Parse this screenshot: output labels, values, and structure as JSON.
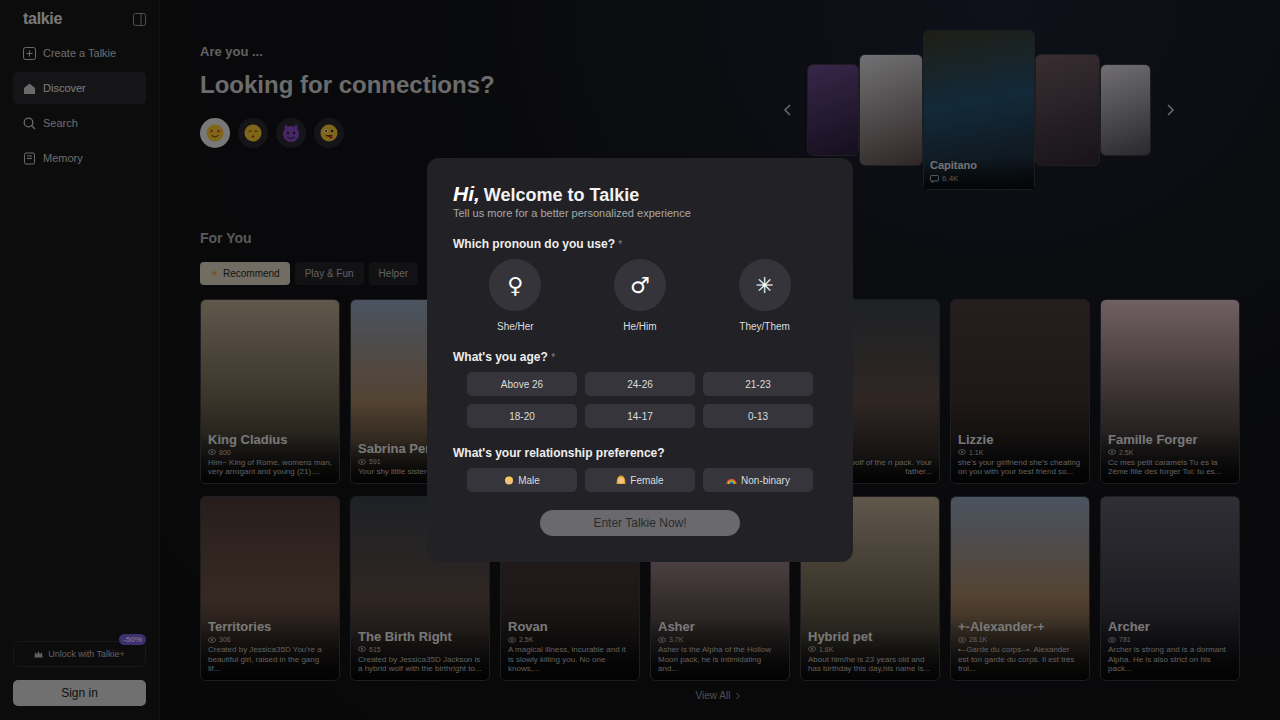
{
  "sidebar": {
    "logo": "talkie",
    "items": [
      {
        "label": "Create a Talkie",
        "kind": "create",
        "selected": false
      },
      {
        "label": "Discover",
        "kind": "home",
        "selected": true
      },
      {
        "label": "Search",
        "kind": "search",
        "selected": false
      },
      {
        "label": "Memory",
        "kind": "memory",
        "selected": false
      }
    ],
    "promo": {
      "label": "Unlock with Talkie+",
      "badge": "-50%"
    },
    "sign_in": "Sign in"
  },
  "hero": {
    "kicker": "Are you ...",
    "title": "Looking for connections?",
    "moods": [
      {
        "kind": "love",
        "selected": true
      },
      {
        "kind": "kiss",
        "selected": false
      },
      {
        "kind": "devil",
        "selected": false
      },
      {
        "kind": "silly",
        "selected": false
      }
    ]
  },
  "carousel": {
    "slides": [
      {
        "featured": false,
        "name": "",
        "count": ""
      },
      {
        "featured": false,
        "name": "",
        "count": ""
      },
      {
        "featured": true,
        "name": "Capitano",
        "count": "6.4K"
      },
      {
        "featured": false,
        "name": "",
        "count": ""
      },
      {
        "featured": false,
        "name": "",
        "count": ""
      }
    ]
  },
  "section": {
    "title": "For You",
    "tabs": [
      {
        "label": "Recommend",
        "icon": "☀",
        "selected": true
      },
      {
        "label": "Play & Fun",
        "icon": "",
        "selected": false
      },
      {
        "label": "Helper",
        "icon": "",
        "selected": false
      }
    ]
  },
  "cards": {
    "rows": [
      [
        {
          "kind": "full",
          "name": "King Cladius",
          "count": "800",
          "desc": "Him~ King of Rome, womens man, very arrogant and young (21)...."
        },
        {
          "kind": "full",
          "name": "Sabrina Penn",
          "count": "591",
          "desc": "Your shy little sister"
        },
        {
          "kind": "hidden",
          "name": "",
          "count": "",
          "desc": ""
        },
        {
          "kind": "hidden",
          "name": "",
          "count": "",
          "desc": ""
        },
        {
          "kind": "partial",
          "name": "",
          "count": "",
          "desc": "lpha werewolf of the n pack. Your father..."
        },
        {
          "kind": "full",
          "name": "Lizzie",
          "count": "1.1K",
          "desc": "she's your girlfriend she's cheating on you with your best friend so..."
        },
        {
          "kind": "full",
          "name": "Famille Forger",
          "count": "2.5K",
          "desc": "Cc mes petit caramels Tu es la 2ème fille des forger Toi: tu es..."
        }
      ],
      [
        {
          "kind": "full",
          "name": "Territories",
          "count": "306",
          "desc": "Created by Jessica35D You're a beautiful girl, raised in the gang lif..."
        },
        {
          "kind": "full",
          "name": "The Birth Right",
          "count": "615",
          "desc": "Created by Jessica35D Jackson is a hybrid wolf with the birthright to..."
        },
        {
          "kind": "full",
          "name": "Rovan",
          "count": "2.5K",
          "desc": "A magical illness, incurable and it is slowly killing you. No one knows,..."
        },
        {
          "kind": "full",
          "name": "Asher",
          "count": "3.7K",
          "desc": "Asher is the Alpha of the Hollow Moon pack, he is intimidating and..."
        },
        {
          "kind": "full",
          "name": "Hybrid pet",
          "count": "1.6K",
          "desc": "About him/he is 23 years old and has birthday this day,his name is..."
        },
        {
          "kind": "full",
          "name": "+-Alexander-+",
          "count": "28.1K",
          "desc": "•--Garde du corps--•. Alexander est ton garde du corps. Il est très froi..."
        },
        {
          "kind": "full",
          "name": "Archer",
          "count": "781",
          "desc": "Archer is strong and is a dormant Alpha. He is also strict on his pack..."
        }
      ]
    ]
  },
  "view_all": "View All",
  "modal": {
    "hi": "Hi,",
    "title": "Welcome to Talkie",
    "subtitle": "Tell us more for a better personalized experience",
    "pronoun": {
      "question": "Which pronoun do you use?",
      "mark": "*",
      "options": [
        {
          "symbol": "♀",
          "label": "She/Her",
          "selected": false
        },
        {
          "symbol": "♂",
          "label": "He/Him",
          "selected": false
        },
        {
          "symbol": "✳",
          "label": "They/Them",
          "selected": false
        }
      ]
    },
    "age": {
      "question": "What's you age?",
      "mark": "*",
      "options": [
        {
          "label": "Above 26",
          "selected": false
        },
        {
          "label": "24-26",
          "selected": false
        },
        {
          "label": "21-23",
          "selected": false
        },
        {
          "label": "18-20",
          "selected": false
        },
        {
          "label": "14-17",
          "selected": false
        },
        {
          "label": "0-13",
          "selected": false
        }
      ]
    },
    "preference": {
      "question": "What's your relationship preference?",
      "options": [
        {
          "kind": "male",
          "label": "Male",
          "selected": false
        },
        {
          "kind": "female",
          "label": "Female",
          "selected": false
        },
        {
          "kind": "nonbinary",
          "label": "Non-binary",
          "selected": false
        }
      ]
    },
    "button": {
      "label": "Enter Talkie Now!",
      "disabled": true
    }
  }
}
